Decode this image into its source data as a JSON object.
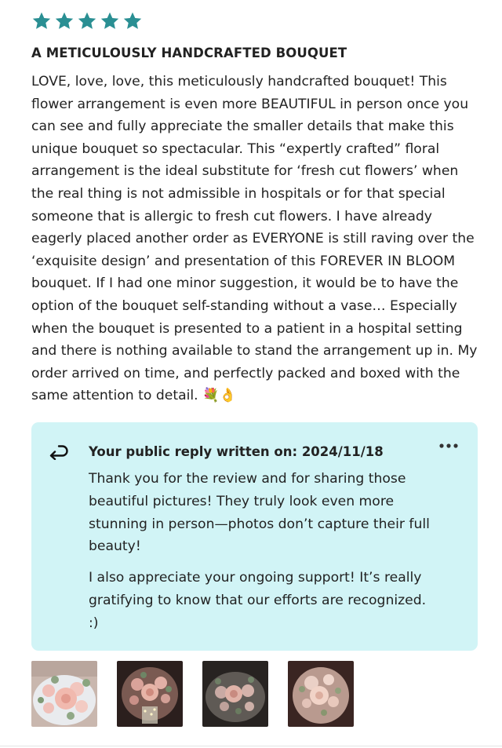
{
  "review": {
    "rating": 5,
    "title": "A METICULOUSLY HANDCRAFTED BOUQUET",
    "body": "LOVE, love, love, this meticulously handcrafted bouquet! This flower arrangement is even more BEAUTIFUL in person once you can see and fully appreciate the smaller details that make this unique bouquet so spectacular. This “expertly crafted” floral arrangement is the ideal substitute for ‘fresh cut flowers’ when the real thing is not admissible in hospitals or for that special someone that is allergic to fresh cut flowers. I have already eagerly placed another order as EVERYONE is still raving over the ‘exquisite design’ and presentation of this FOREVER IN BLOOM bouquet. If I had one minor suggestion, it would be to have the option of the bouquet self-standing without a vase… Especially when the bouquet is presented to a patient in a hospital setting and there is nothing available to stand the arrangement up in. My order arrived on time, and perfectly packed and boxed with the same attention to detail. 💐👌"
  },
  "reply": {
    "header": "Your public reply written on: 2024/11/18",
    "paragraph_1": "Thank you for the review and for sharing those beautiful pictures! They truly look even more stunning in person—photos don’t capture their full beauty!",
    "paragraph_2": "I also appreciate your ongoing support! It’s really gratifying to know that our efforts are recognized. :)"
  },
  "icons": {
    "star": "star-icon",
    "reply": "reply-arrow-icon",
    "more": "more-horizontal-icon"
  },
  "colors": {
    "star": "#2a8f93",
    "reply_background": "#d1f4f6",
    "text": "#222222"
  },
  "photos": [
    {
      "name": "bouquet-photo-1"
    },
    {
      "name": "bouquet-photo-2"
    },
    {
      "name": "bouquet-photo-3"
    },
    {
      "name": "bouquet-photo-4"
    }
  ]
}
